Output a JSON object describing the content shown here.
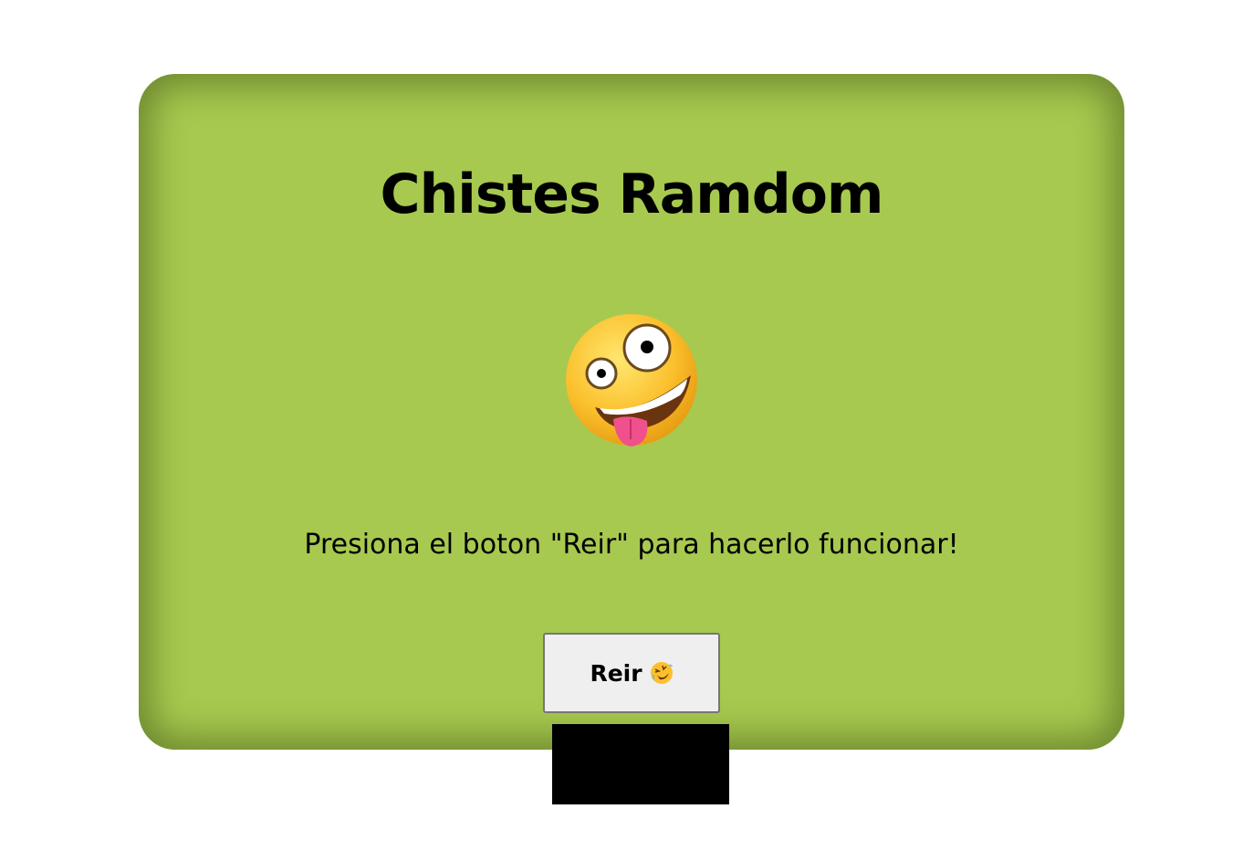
{
  "card": {
    "title": "Chistes Ramdom",
    "face_icon": "zany-face-icon",
    "instructions": "Presiona el boton \"Reir\" para hacerlo funcionar!",
    "button": {
      "label": "Reir",
      "icon": "rolling-on-floor-laughing-icon"
    }
  },
  "colors": {
    "background": "#ffffff",
    "card": "#a7c94f",
    "button_bg": "#efefef",
    "redaction": "#000000"
  }
}
